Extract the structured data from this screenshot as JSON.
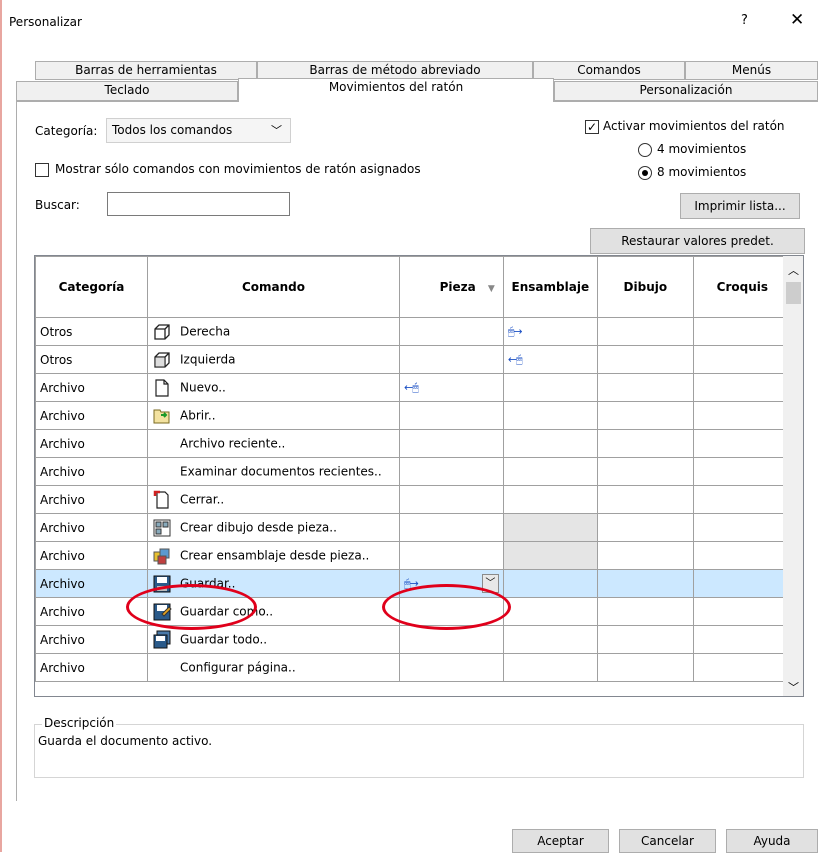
{
  "window": {
    "title": "Personalizar",
    "help_glyph": "?",
    "close_glyph": "✕"
  },
  "tabs_row1": [
    {
      "label": "Barras de herramientas"
    },
    {
      "label": "Barras de método abreviado"
    },
    {
      "label": "Comandos"
    },
    {
      "label": "Menús"
    }
  ],
  "tabs_row2": [
    {
      "label": "Teclado"
    },
    {
      "label": "Movimientos del ratón",
      "active": true
    },
    {
      "label": "Personalización"
    }
  ],
  "filters": {
    "category_label": "Categoría:",
    "category_value": "Todos los comandos",
    "only_assigned_label": "Mostrar sólo comandos con movimientos de ratón asignados",
    "search_label": "Buscar:",
    "search_value": ""
  },
  "gestures": {
    "enable_label": "Activar movimientos del ratón",
    "enable_checked": true,
    "opt4_label": "4 movimientos",
    "opt8_label": "8 movimientos",
    "selected": "8"
  },
  "buttons": {
    "print": "Imprimir lista...",
    "restore": "Restaurar valores predet.",
    "ok": "Aceptar",
    "cancel": "Cancelar",
    "help": "Ayuda"
  },
  "table": {
    "headers": {
      "categoria": "Categoría",
      "comando": "Comando",
      "pieza": "Pieza",
      "pieza_sort": "▼",
      "ensamblaje": "Ensamblaje",
      "dibujo": "Dibujo",
      "croquis": "Croquis"
    },
    "rows": [
      {
        "cat": "Otros",
        "cmd": "Derecha",
        "icon": "cube-right-icon",
        "pieza": "",
        "ensamblaje": "🖱→"
      },
      {
        "cat": "Otros",
        "cmd": "Izquierda",
        "icon": "cube-left-icon",
        "pieza": "",
        "ensamblaje": "←🖱"
      },
      {
        "cat": "Archivo",
        "cmd": "Nuevo..",
        "icon": "new-document-icon",
        "pieza": "←🖱",
        "ensamblaje": ""
      },
      {
        "cat": "Archivo",
        "cmd": "Abrir..",
        "icon": "open-folder-icon",
        "pieza": "",
        "ensamblaje": ""
      },
      {
        "cat": "Archivo",
        "cmd": "Archivo reciente..",
        "icon": "",
        "pieza": "",
        "ensamblaje": ""
      },
      {
        "cat": "Archivo",
        "cmd": "Examinar documentos recientes..",
        "icon": "",
        "pieza": "",
        "ensamblaje": ""
      },
      {
        "cat": "Archivo",
        "cmd": "Cerrar..",
        "icon": "close-document-icon",
        "pieza": "",
        "ensamblaje": ""
      },
      {
        "cat": "Archivo",
        "cmd": "Crear dibujo desde pieza..",
        "icon": "drawing-from-part-icon",
        "pieza": "",
        "ensamblaje": "",
        "shade_ens": true
      },
      {
        "cat": "Archivo",
        "cmd": "Crear ensamblaje desde pieza..",
        "icon": "assembly-from-part-icon",
        "pieza": "",
        "ensamblaje": "",
        "shade_ens": true
      },
      {
        "cat": "Archivo",
        "cmd": "Guardar..",
        "icon": "save-icon",
        "pieza": "🖱→",
        "ensamblaje": "",
        "selected": true
      },
      {
        "cat": "Archivo",
        "cmd": "Guardar como..",
        "icon": "save-as-icon",
        "pieza": "",
        "ensamblaje": ""
      },
      {
        "cat": "Archivo",
        "cmd": "Guardar todo..",
        "icon": "save-all-icon",
        "pieza": "",
        "ensamblaje": ""
      },
      {
        "cat": "Archivo",
        "cmd": "Configurar página..",
        "icon": "",
        "pieza": "",
        "ensamblaje": ""
      }
    ]
  },
  "description": {
    "title": "Descripción",
    "text": "Guarda el documento activo."
  },
  "colors": {
    "selected_row": "#cce8ff",
    "highlight_ring": "#e0001b",
    "mouse_arrow": "#1a4fc4"
  }
}
